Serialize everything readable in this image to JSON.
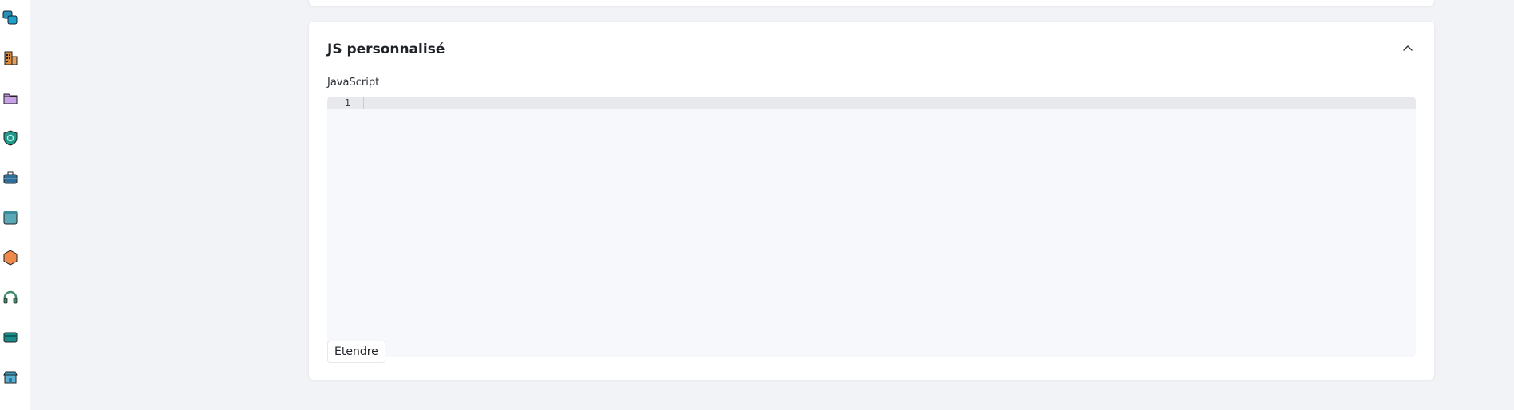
{
  "sidebar": {
    "items": [
      {
        "icon": "shapes-icon",
        "colors": [
          "#2a8fb5",
          "#1a6a8a"
        ]
      },
      {
        "icon": "building-icon",
        "colors": [
          "#d98a3c"
        ]
      },
      {
        "icon": "folder-icon",
        "colors": [
          "#b58ad8"
        ]
      },
      {
        "icon": "shield-icon",
        "colors": [
          "#1f9a8a"
        ]
      },
      {
        "icon": "briefcase-icon",
        "colors": [
          "#2f6e96"
        ]
      },
      {
        "icon": "window-icon",
        "colors": [
          "#5aa9b8"
        ]
      },
      {
        "icon": "hexagon-icon",
        "colors": [
          "#f08a4b"
        ]
      },
      {
        "icon": "headset-icon",
        "colors": [
          "#3f8a6a"
        ]
      },
      {
        "icon": "credit-card-icon",
        "colors": [
          "#1a8a8a"
        ]
      },
      {
        "icon": "storefront-icon",
        "colors": [
          "#3a9ac0"
        ]
      }
    ]
  },
  "section": {
    "title": "JS personnalisé",
    "collapse_icon": "chevron-up-icon",
    "field_label": "JavaScript",
    "editor": {
      "line_numbers": [
        "1"
      ],
      "content": ""
    },
    "expand_label": "Etendre"
  }
}
